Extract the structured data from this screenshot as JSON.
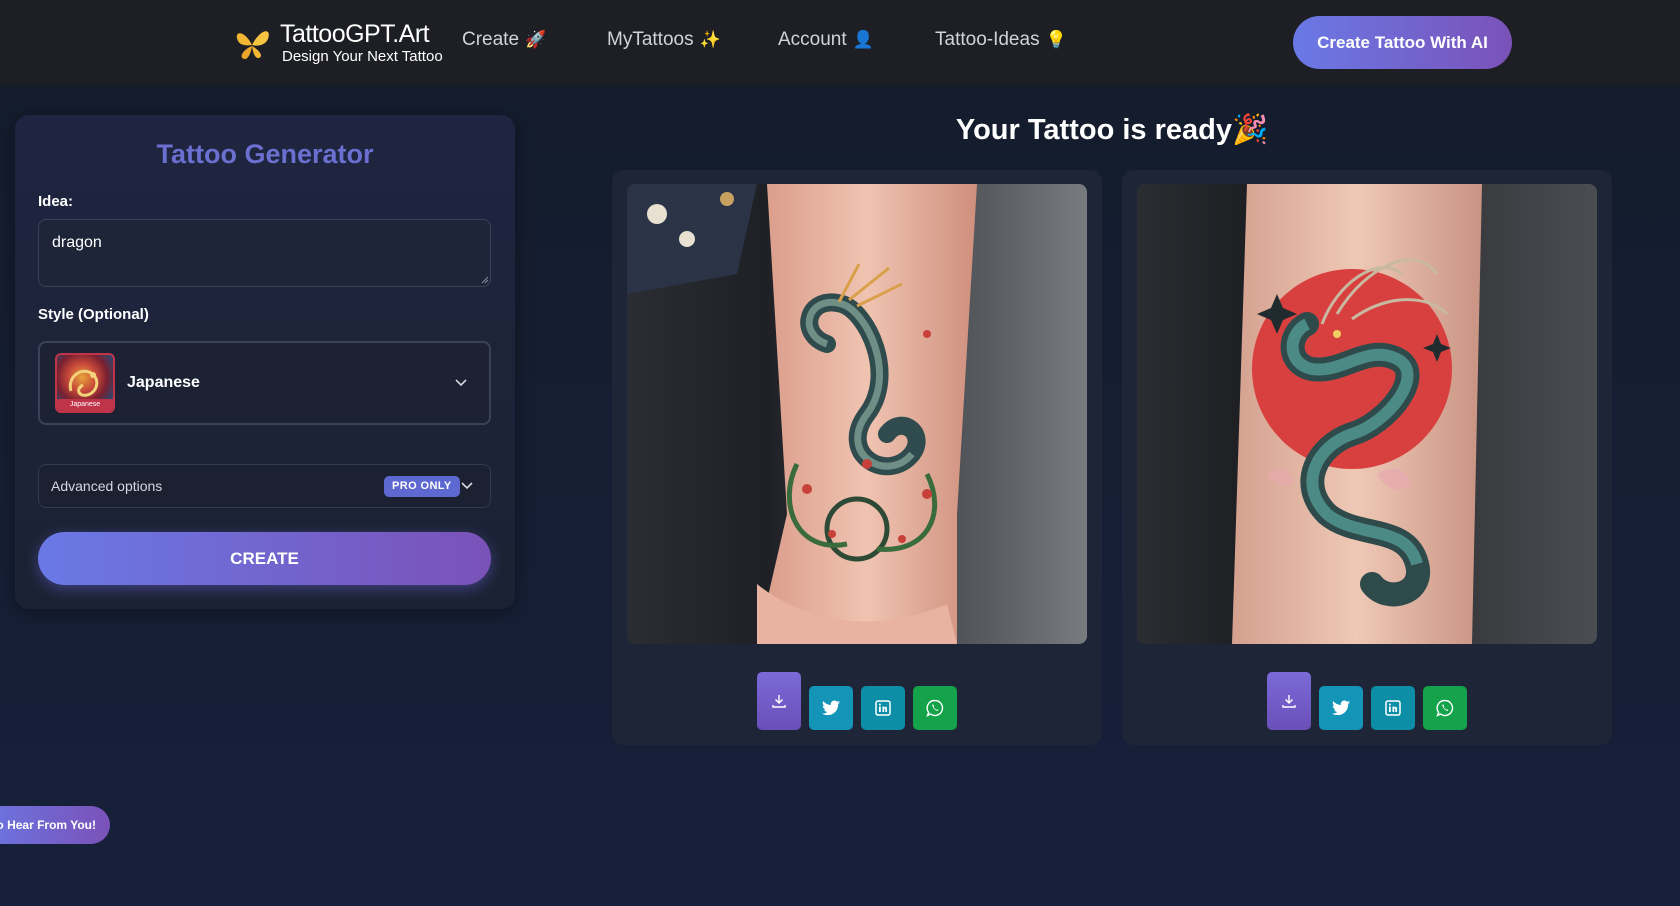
{
  "nav": {
    "brand_name": "TattooGPT.Art",
    "brand_tagline": "Design Your Next Tattoo",
    "links": [
      {
        "label": "Create",
        "emoji": "🚀"
      },
      {
        "label": "MyTattoos",
        "emoji": "✨"
      },
      {
        "label": "Account",
        "emoji": "👤"
      },
      {
        "label": "Tattoo-Ideas",
        "emoji": "💡"
      }
    ],
    "cta_label": "Create Tattoo With AI"
  },
  "generator": {
    "title": "Tattoo Generator",
    "idea_label": "Idea:",
    "idea_value": "dragon",
    "style_label": "Style (Optional)",
    "style_value": "Japanese",
    "style_thumb_caption": "Japanese",
    "advanced_label": "Advanced options",
    "pro_badge": "PRO ONLY",
    "create_label": "CREATE"
  },
  "results": {
    "title": "Your Tattoo is ready🎉",
    "cards": [
      {
        "image": "dragon-forearm-tattoo-1",
        "actions": [
          "download-icon",
          "twitter-icon",
          "linkedin-icon",
          "whatsapp-icon"
        ]
      },
      {
        "image": "dragon-forearm-tattoo-red-sun",
        "actions": [
          "download-icon",
          "twitter-icon",
          "linkedin-icon",
          "whatsapp-icon"
        ]
      }
    ]
  },
  "feedback": {
    "label": "o Hear From You!"
  },
  "colors": {
    "accent_start": "#6a79e6",
    "accent_end": "#7a52b8",
    "nav_bg": "#1d1f24",
    "panel_title": "#6a6fd0"
  }
}
